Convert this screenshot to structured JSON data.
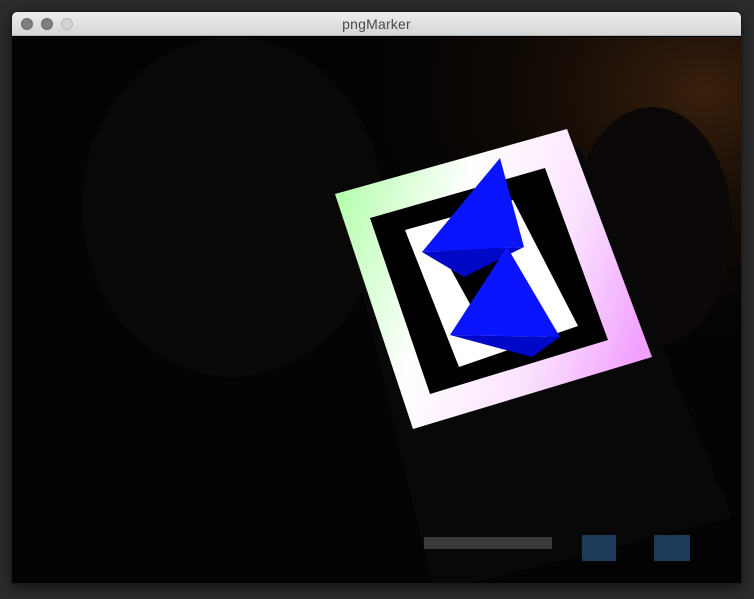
{
  "window": {
    "title": "pngMarker"
  },
  "scene": {
    "marker_outer_colors": [
      "#b6ffb0",
      "#ffffff",
      "#f6a6ff"
    ],
    "marker_border_color": "#000000",
    "virtual_object_color": "#0a14ff",
    "virtual_object_shade": "#0008c8"
  }
}
